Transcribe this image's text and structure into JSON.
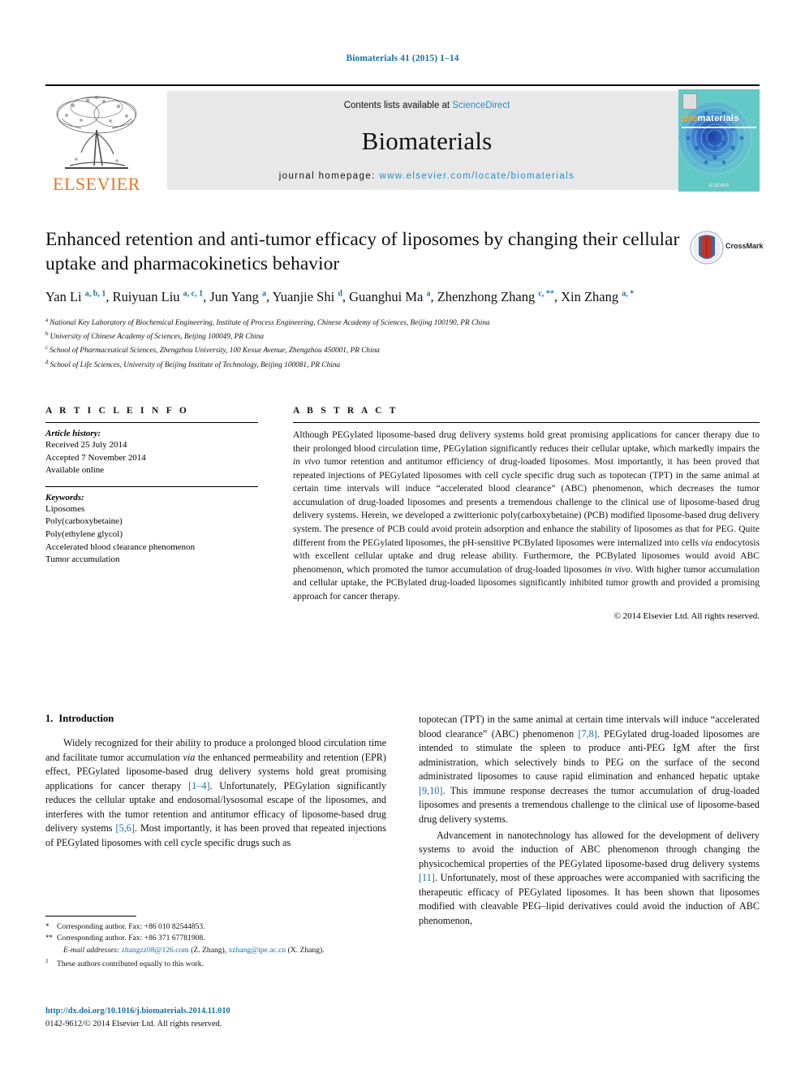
{
  "journal_ref": "Biomaterials 41 (2015) 1–14",
  "header": {
    "contents_prefix": "Contents lists available at ",
    "sciencedirect": "ScienceDirect",
    "journal_name": "Biomaterials",
    "homepage_prefix": "journal homepage: ",
    "homepage_url": "www.elsevier.com/locate/biomaterials",
    "publisher_logo_text": "ELSEVIER",
    "publisher_logo_icon": "elsevier-tree-icon",
    "cover": {
      "title_part1": "Bio",
      "title_part2": "materials",
      "footer": "ELSEVIER"
    },
    "accent_blue": "#2a8fc4",
    "elsevier_orange": "#E87722",
    "band_gray": "#e8e8e8"
  },
  "title_block": {
    "title": "Enhanced retention and anti-tumor efficacy of liposomes by changing their cellular uptake and pharmacokinetics behavior",
    "crossmark_label": "CrossMark",
    "authors": [
      {
        "name": "Yan Li",
        "marks": "a, b, 1",
        "sep": ", "
      },
      {
        "name": "Ruiyuan Liu",
        "marks": "a, c, 1",
        "sep": ", "
      },
      {
        "name": "Jun Yang",
        "marks": "a",
        "sep": ", "
      },
      {
        "name": "Yuanjie Shi",
        "marks": "d",
        "sep": ", "
      },
      {
        "name": "Guanghui Ma",
        "marks": "a",
        "sep": ", "
      },
      {
        "name": "Zhenzhong Zhang",
        "marks": "c, **",
        "sep": ", "
      },
      {
        "name": "Xin Zhang",
        "marks": "a, *",
        "sep": ""
      }
    ],
    "affiliations": [
      {
        "mark": "a",
        "text": "National Key Laboratory of Biochemical Engineering, Institute of Process Engineering, Chinese Academy of Sciences, Beijing 100190, PR China"
      },
      {
        "mark": "b",
        "text": "University of Chinese Academy of Sciences, Beijing 100049, PR China"
      },
      {
        "mark": "c",
        "text": "School of Pharmaceutical Sciences, Zhengzhou University, 100 Kexue Avenue, Zhengzhou 450001, PR China"
      },
      {
        "mark": "d",
        "text": "School of Life Sciences, University of Beijing Institute of Technology, Beijing 100081, PR China"
      }
    ]
  },
  "article_info": {
    "heading": "A R T I C L E   I N F O",
    "history_label": "Article history:",
    "history": [
      "Received 25 July 2014",
      "Accepted 7 November 2014",
      "Available online"
    ],
    "keywords_label": "Keywords:",
    "keywords": [
      "Liposomes",
      "Poly(carboxybetaine)",
      "Poly(ethylene glycol)",
      "Accelerated blood clearance phenomenon",
      "Tumor accumulation"
    ]
  },
  "abstract": {
    "heading": "A B S T R A C T",
    "part1": "Although PEGylated liposome-based drug delivery systems hold great promising applications for cancer therapy due to their prolonged blood circulation time, PEGylation significantly reduces their cellular uptake, which markedly impairs the ",
    "italic1": "in vivo",
    "part2": " tumor retention and antitumor efficiency of drug-loaded liposomes. Most importantly, it has been proved that repeated injections of PEGylated liposomes with cell cycle specific drug such as topotecan (TPT) in the same animal at certain time intervals will induce “accelerated blood clearance” (ABC) phenomenon, which decreases the tumor accumulation of drug-loaded liposomes and presents a tremendous challenge to the clinical use of liposome-based drug delivery systems. Herein, we developed a zwitterionic poly(carboxybetaine) (PCB) modified liposome-based drug delivery system. The presence of PCB could avoid protein adsorption and enhance the stability of liposomes as that for PEG. Quite different from the PEGylated liposomes, the pH-sensitive PCBylated liposomes were internalized into cells ",
    "italic2": "via",
    "part3": " endocytosis with excellent cellular uptake and drug release ability. Furthermore, the PCBylated liposomes would avoid ABC phenomenon, which promoted the tumor accumulation of drug-loaded liposomes ",
    "italic3": "in vivo",
    "part4": ". With higher tumor accumulation and cellular uptake, the PCBylated drug-loaded liposomes significantly inhibited tumor growth and provided a promising approach for cancer therapy.",
    "copyright": "© 2014 Elsevier Ltd. All rights reserved."
  },
  "introduction": {
    "number": "1.",
    "heading": "Introduction",
    "left_p1_a": "Widely recognized for their ability to produce a prolonged blood circulation time and facilitate tumor accumulation ",
    "left_p1_i1": "via",
    "left_p1_b": " the enhanced permeability and retention (EPR) effect, PEGylated liposome-based drug delivery systems hold great promising applications for cancer therapy ",
    "left_ref1": "[1–4]",
    "left_p1_c": ". Unfortunately, PEGylation significantly reduces the cellular uptake and endosomal/lysosomal escape of the liposomes, and interferes with the tumor retention and antitumor efficacy of liposome-based drug delivery systems ",
    "left_ref2": "[5,6]",
    "left_p1_d": ". Most importantly, it has been proved that repeated injections of PEGylated liposomes with cell cycle specific drugs such as",
    "right_p1_a": "topotecan (TPT) in the same animal at certain time intervals will induce “accelerated blood clearance” (ABC) phenomenon ",
    "right_ref1": "[7,8]",
    "right_p1_b": ". PEGylated drug-loaded liposomes are intended to stimulate the spleen to produce anti-PEG IgM after the first administration, which selectively binds to PEG on the surface of the second administrated liposomes to cause rapid elimination and enhanced hepatic uptake ",
    "right_ref2": "[9,10]",
    "right_p1_c": ". This immune response decreases the tumor accumulation of drug-loaded liposomes and presents a tremendous challenge to the clinical use of liposome-based drug delivery systems.",
    "right_p2_a": "Advancement in nanotechnology has allowed for the development of delivery systems to avoid the induction of ABC phenomenon through changing the physicochemical properties of the PEGylated liposome-based drug delivery systems ",
    "right_ref3": "[11]",
    "right_p2_b": ". Unfortunately, most of these approaches were accompanied with sacrificing the therapeutic efficacy of PEGylated liposomes. It has been shown that liposomes modified with cleavable PEG–lipid derivatives could avoid the induction of ABC phenomenon,"
  },
  "footnotes": {
    "corresponding1_mark": "*",
    "corresponding1": "Corresponding author. Fax: +86 010 82544853.",
    "corresponding2_mark": "**",
    "corresponding2": "Corresponding author. Fax: +86 371 67781908.",
    "email_label": "E-mail addresses:",
    "email1": "zhangzz08@126.com",
    "email1_owner": " (Z. Zhang), ",
    "email2": "xzhang@ipe.ac.cn",
    "email2_owner": " (X. Zhang).",
    "equal_mark": "1",
    "equal_contrib": "These authors contributed equally to this work.",
    "doi": "http://dx.doi.org/10.1016/j.biomaterials.2014.11.010",
    "issn": "0142-9612/© 2014 Elsevier Ltd. All rights reserved."
  }
}
